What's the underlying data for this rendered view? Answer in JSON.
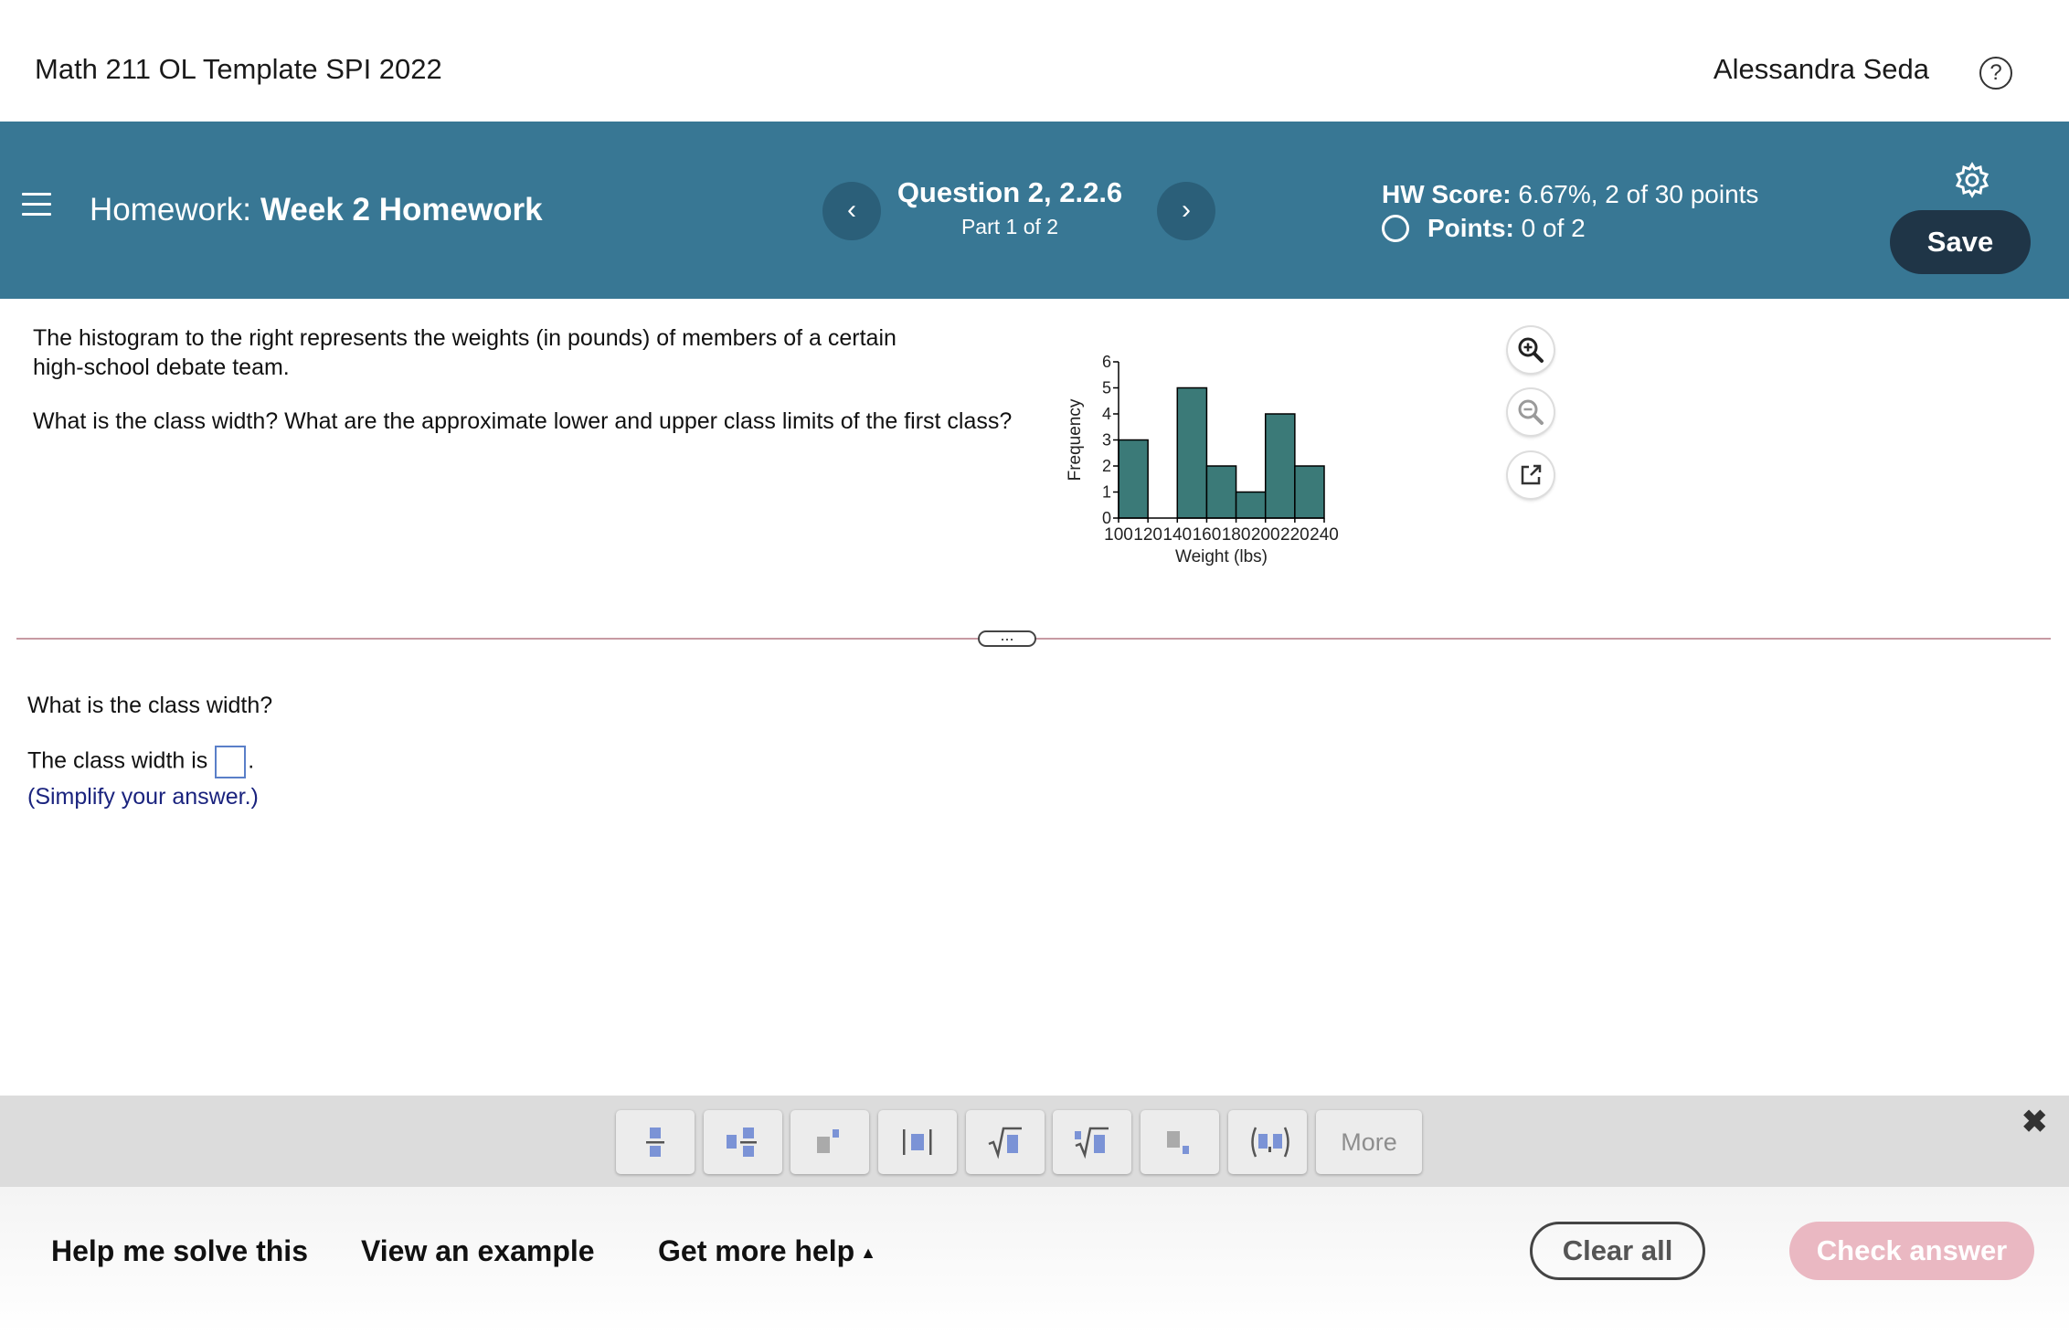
{
  "header": {
    "course_title": "Math 211 OL Template SPI 2022",
    "user_name": "Alessandra Seda",
    "help_glyph": "?"
  },
  "homework": {
    "label": "Homework:",
    "name": "Week 2 Homework",
    "question_title": "Question 2, 2.2.6",
    "question_part": "Part 1 of 2",
    "hw_score_label": "HW Score:",
    "hw_score_value": "6.67%, 2 of 30 points",
    "points_label": "Points:",
    "points_value": "0 of 2",
    "save_label": "Save",
    "prev_glyph": "‹",
    "next_glyph": "›"
  },
  "question": {
    "line1": "The histogram to the right represents the weights (in pounds) of members of a certain",
    "line2": "high-school debate team.",
    "line3": "What is the class width? What are the approximate lower and upper class limits of the first class?"
  },
  "chart_data": {
    "type": "bar",
    "bin_edges": [
      100,
      120,
      140,
      160,
      180,
      200,
      220,
      240
    ],
    "values": [
      3,
      0,
      5,
      2,
      1,
      4,
      2
    ],
    "xticks": [
      "100",
      "120",
      "140",
      "160",
      "180",
      "200",
      "220",
      "240"
    ],
    "yticks": [
      "0",
      "1",
      "2",
      "3",
      "4",
      "5",
      "6"
    ],
    "xlabel": "Weight (lbs)",
    "ylabel": "Frequency",
    "ylim": [
      0,
      6
    ],
    "bar_color": "#3b7a78"
  },
  "answer": {
    "prompt": "What is the class width?",
    "sentence_start": "The class width is",
    "sentence_end": ".",
    "hint": "(Simplify your answer.)"
  },
  "toolbar": {
    "more_label": "More",
    "close_glyph": "✖"
  },
  "footer": {
    "help_me_solve": "Help me solve this",
    "view_example": "View an example",
    "get_more_help": "Get more help",
    "caret": "▲",
    "clear_all": "Clear all",
    "check_answer": "Check answer"
  },
  "colors": {
    "banner": "#387794",
    "save_button": "#1f3547",
    "check_answer": "#eab8c2",
    "hint_text": "#1a237e"
  }
}
